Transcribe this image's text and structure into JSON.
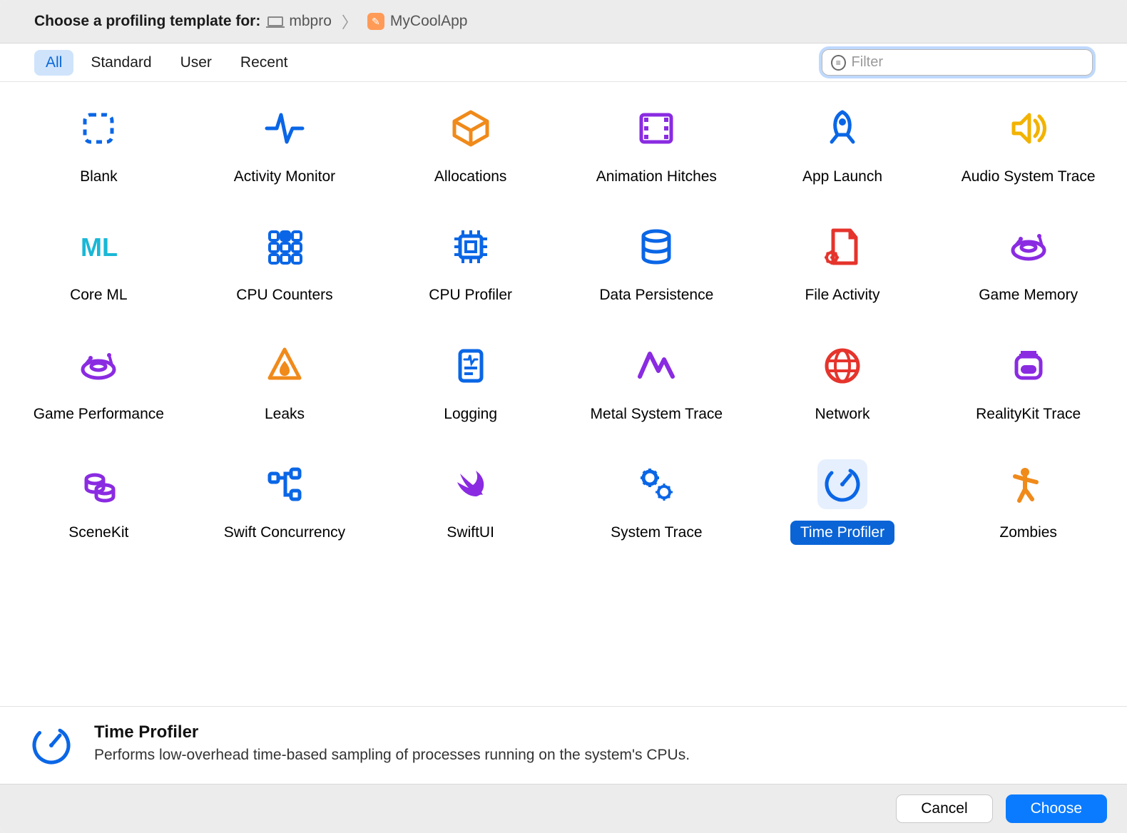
{
  "header": {
    "title": "Choose a profiling template for:",
    "breadcrumb": {
      "device": "mbpro",
      "app": "MyCoolApp"
    }
  },
  "filterTabs": {
    "items": [
      "All",
      "Standard",
      "User",
      "Recent"
    ],
    "active": 0
  },
  "filter": {
    "placeholder": "Filter",
    "value": ""
  },
  "templates": [
    {
      "name": "Blank",
      "icon": "blank",
      "color": "#0a66e6"
    },
    {
      "name": "Activity Monitor",
      "icon": "activity",
      "color": "#0a66e6"
    },
    {
      "name": "Allocations",
      "icon": "allocations",
      "color": "#f08a1a"
    },
    {
      "name": "Animation Hitches",
      "icon": "animation",
      "color": "#8a2be2"
    },
    {
      "name": "App Launch",
      "icon": "launch",
      "color": "#0a66e6"
    },
    {
      "name": "Audio System Trace",
      "icon": "audio",
      "color": "#f2b300"
    },
    {
      "name": "Core ML",
      "icon": "coreml",
      "color": "#1ab7d6"
    },
    {
      "name": "CPU Counters",
      "icon": "counters",
      "color": "#0a66e6"
    },
    {
      "name": "CPU Profiler",
      "icon": "cpuprofiler",
      "color": "#0a66e6"
    },
    {
      "name": "Data Persistence",
      "icon": "datapersist",
      "color": "#0a66e6"
    },
    {
      "name": "File Activity",
      "icon": "fileactivity",
      "color": "#e5342c"
    },
    {
      "name": "Game Memory",
      "icon": "gamememory",
      "color": "#8a2be2"
    },
    {
      "name": "Game Performance",
      "icon": "gameperf",
      "color": "#8a2be2"
    },
    {
      "name": "Leaks",
      "icon": "leaks",
      "color": "#f08a1a"
    },
    {
      "name": "Logging",
      "icon": "logging",
      "color": "#0a66e6"
    },
    {
      "name": "Metal System Trace",
      "icon": "metal",
      "color": "#8a2be2"
    },
    {
      "name": "Network",
      "icon": "network",
      "color": "#e5342c"
    },
    {
      "name": "RealityKit Trace",
      "icon": "realitykit",
      "color": "#8a2be2"
    },
    {
      "name": "SceneKit",
      "icon": "scenekit",
      "color": "#8a2be2"
    },
    {
      "name": "Swift Concurrency",
      "icon": "concurrency",
      "color": "#0a66e6"
    },
    {
      "name": "SwiftUI",
      "icon": "swiftui",
      "color": "#8a2be2"
    },
    {
      "name": "System Trace",
      "icon": "systemtrace",
      "color": "#0a66e6"
    },
    {
      "name": "Time Profiler",
      "icon": "timeprofiler",
      "color": "#0a66e6"
    },
    {
      "name": "Zombies",
      "icon": "zombies",
      "color": "#f08a1a"
    }
  ],
  "selectedIndex": 22,
  "detail": {
    "title": "Time Profiler",
    "desc": "Performs low-overhead time-based sampling of processes running on the system's CPUs."
  },
  "buttons": {
    "cancel": "Cancel",
    "choose": "Choose"
  }
}
